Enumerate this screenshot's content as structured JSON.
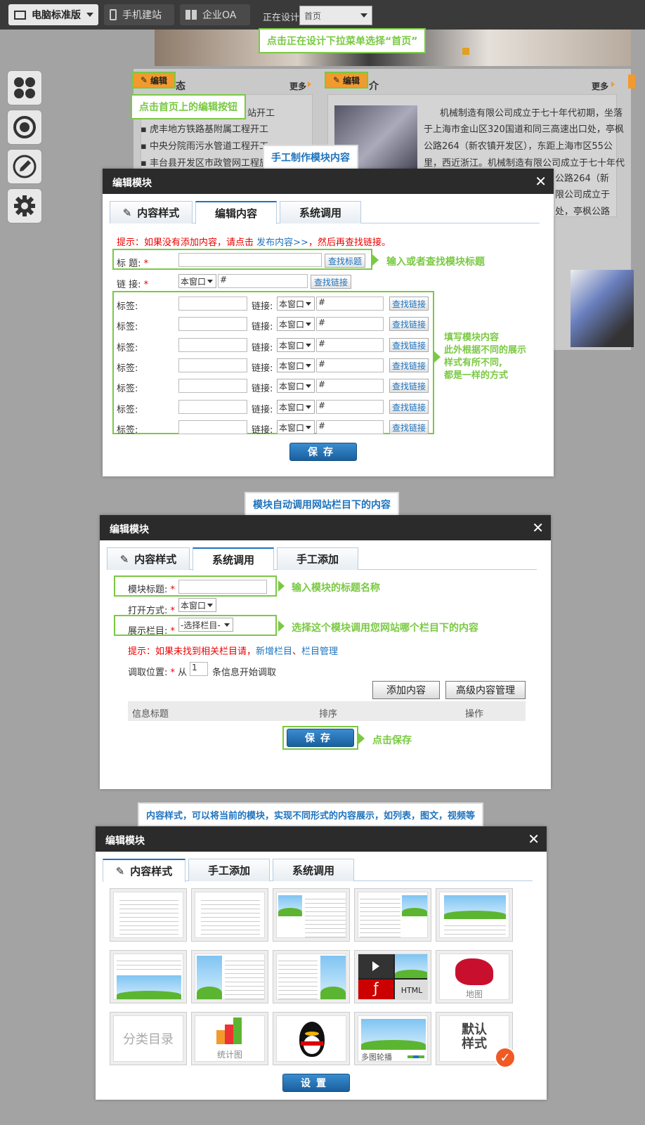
{
  "topbar": {
    "tab_pc": "电脑标准版",
    "tab_mobile": "手机建站",
    "tab_oa": "企业OA",
    "designing_label": "正在设计",
    "page_select_value": "首页"
  },
  "callouts": {
    "select_home": "点击正在设计下拉菜单选择“首页”",
    "click_edit": "点击首页上的编辑按钮",
    "manual_content": "手工制作模块内容",
    "input_title": "输入或者查找模块标题",
    "fill_content": "填写模块内容\n此外根据不同的展示\n样式有所不同,\n都是一样的方式",
    "fill_content_lines": [
      "填写模块内容",
      "此外根据不同的展示",
      "样式有所不同,",
      "都是一样的方式"
    ],
    "auto_call": "模块自动调用网站栏目下的内容",
    "input_module_title": "输入模块的标题名称",
    "choose_column": "选择这个模块调用您网站哪个栏目下的内容",
    "click_save": "点击保存",
    "content_style": "内容样式，可以将当前的模块，实现不同形式的内容展示，如列表，图文，视频等"
  },
  "bg": {
    "edit_label": "编辑",
    "more_label": "更多",
    "section1_tail": "态",
    "section2_tail": "介",
    "news": [
      "站开工",
      "虎丰地方铁路基附属工程开工",
      "中央分院雨污水管道工程开工",
      "丰台县开发区市政管网工程施工"
    ],
    "intro_lines": [
      "机械制造有限公司成立于七十年代初期，坐落",
      "于上海市金山区320国道和同三高速出口处，亭枫",
      "公路264（新农镇开发区），东距上海市区55公",
      "里，西近浙江。机械制造有限公司成立于七十年代",
      "公路264（新",
      "限公司成立于",
      "处，亭枫公路"
    ]
  },
  "modal1": {
    "title": "编辑模块",
    "close": "✕",
    "tabs": [
      "内容样式",
      "编辑内容",
      "系统调用"
    ],
    "hint_prefix": "提示：如果没有添加内容，请点击 ",
    "hint_link": "发布内容>>",
    "hint_suffix": "，然后再查找链接。",
    "title_label": "标  题:",
    "link_label": "链  接:",
    "tag_label": "标签:",
    "link_short": "链接:",
    "window_option": "本窗口",
    "hash": "#",
    "find_title": "查找标题",
    "find_link": "查找链接",
    "save": "保存"
  },
  "modal2": {
    "title": "编辑模块",
    "close": "✕",
    "tabs": [
      "内容样式",
      "系统调用",
      "手工添加"
    ],
    "module_title_label": "模块标题:",
    "open_mode_label": "打开方式:",
    "open_mode_value": "本窗口",
    "column_label": "展示栏目:",
    "column_value": "-选择栏目-",
    "hint_prefix": "提示：如果未找到相关栏目请，",
    "hint_link1": "新增栏目",
    "hint_sep": "、",
    "hint_link2": "栏目管理",
    "fetch_label": "调取位置:",
    "fetch_from": "从",
    "fetch_value": "1",
    "fetch_suffix": "条信息开始调取",
    "add_content": "添加内容",
    "advanced": "高级内容管理",
    "table_headers": [
      "信息标题",
      "排序",
      "操作"
    ],
    "save": "保存"
  },
  "modal3": {
    "title": "编辑模块",
    "close": "✕",
    "tabs": [
      "内容样式",
      "手工添加",
      "系统调用"
    ],
    "thumb_labels": {
      "map": "地图",
      "category": "分类目录",
      "stats": "统计图",
      "carousel": "多图轮播",
      "default_line1": "默认",
      "default_line2": "样式",
      "html": "HTML"
    },
    "set": "设置"
  },
  "colors": {
    "green": "#7ac943",
    "blue": "#1e73be",
    "orange": "#f29a2e",
    "header": "#2b2b2b"
  }
}
